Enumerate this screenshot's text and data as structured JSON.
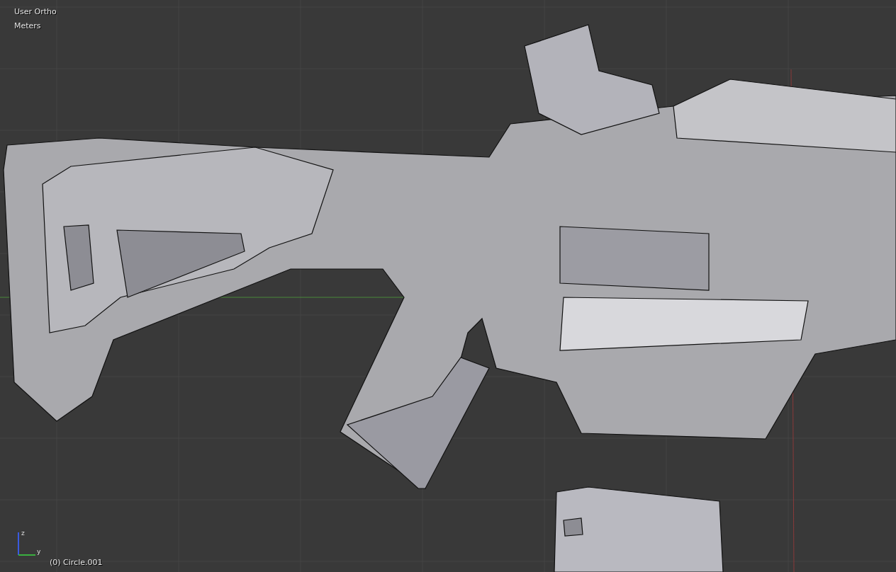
{
  "viewport": {
    "view_name": "User Ortho",
    "units": "Meters",
    "object_info": "(0) Circle.001"
  },
  "axis_gizmo": {
    "labels": [
      "z",
      "y"
    ]
  }
}
